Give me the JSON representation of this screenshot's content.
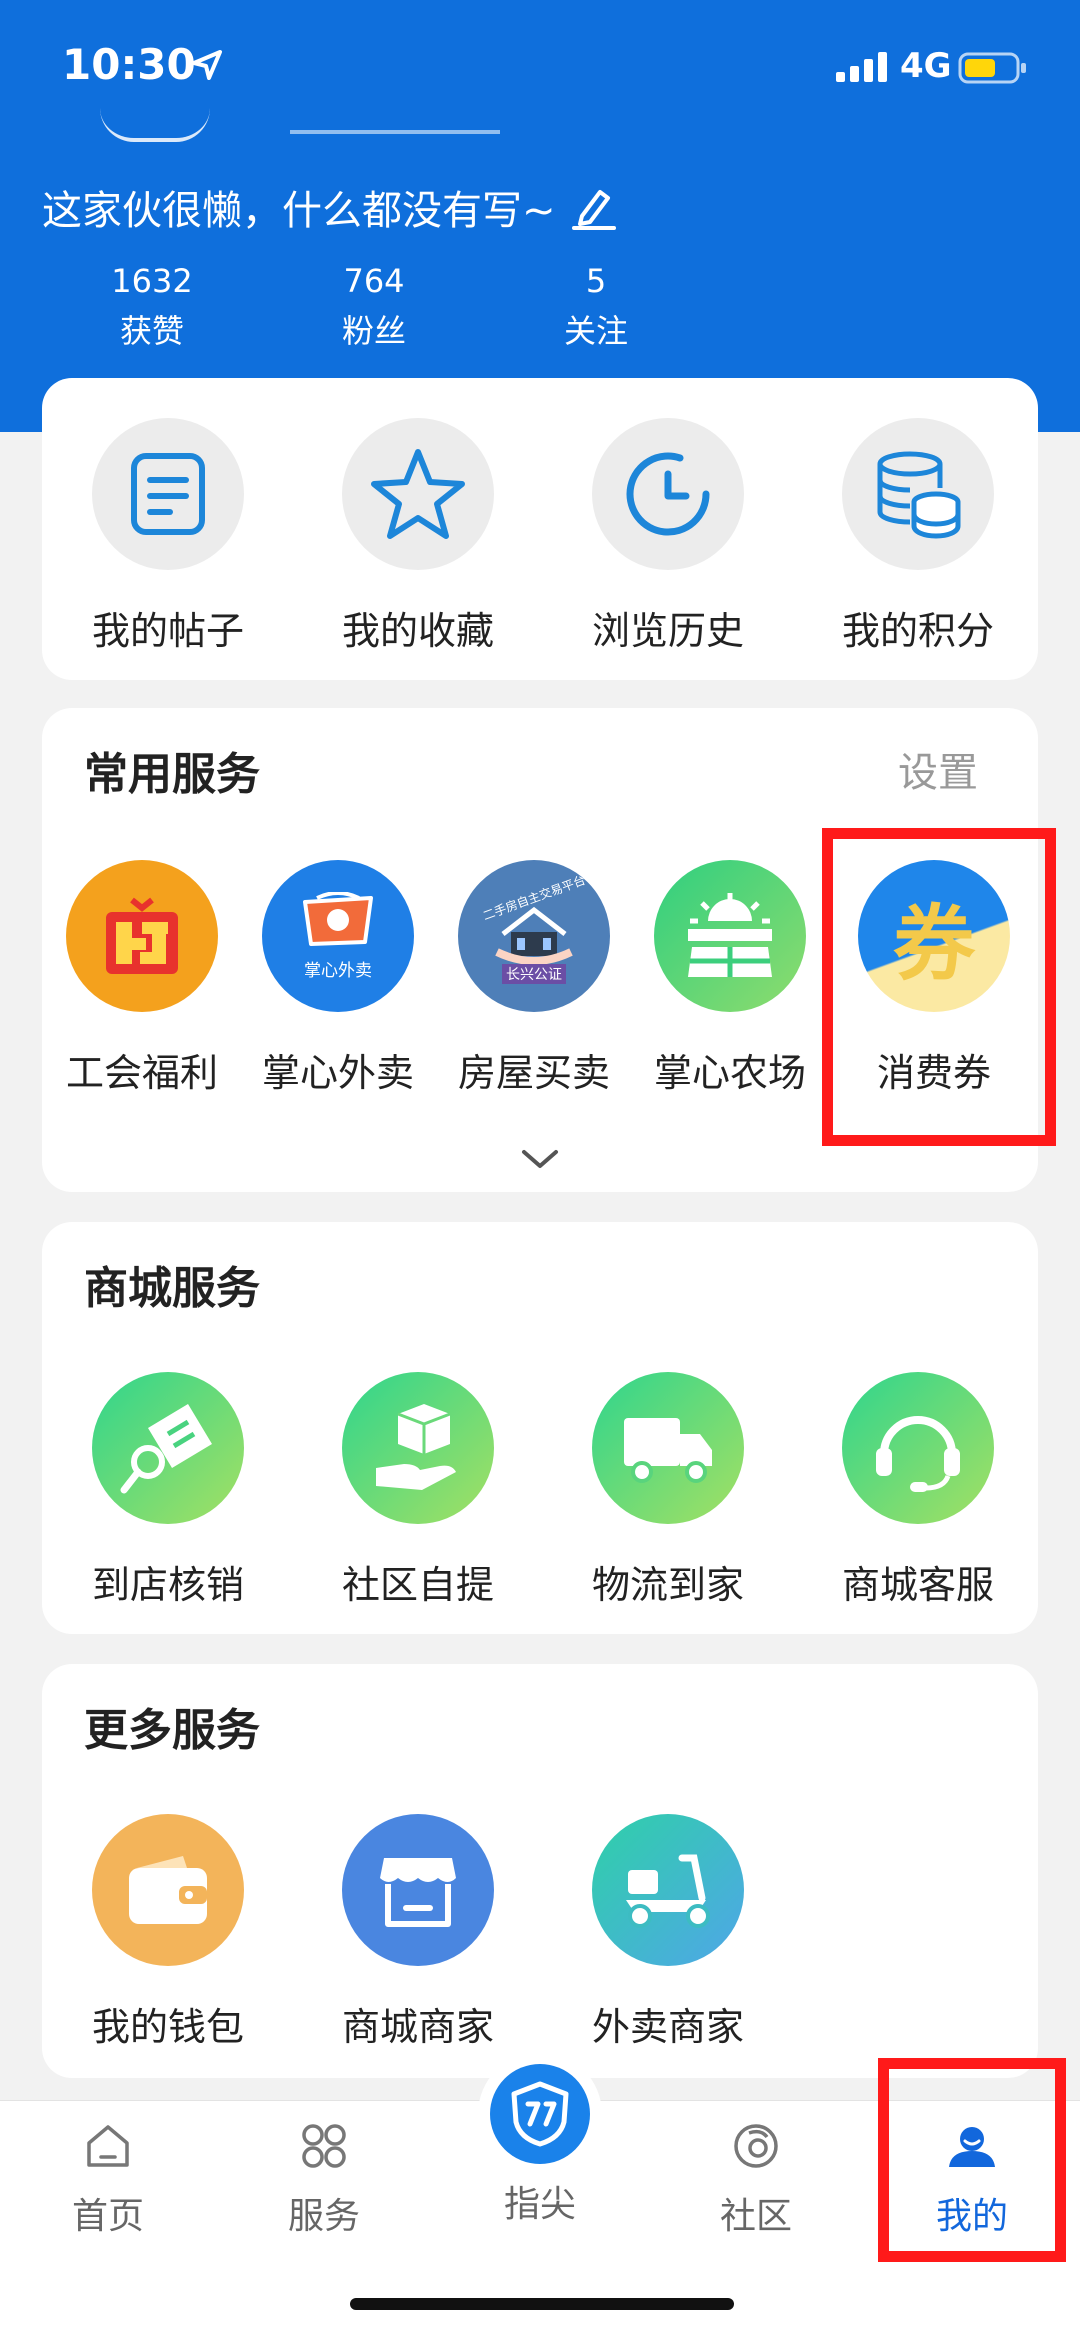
{
  "status_bar": {
    "time": "10:30",
    "network": "4G"
  },
  "profile": {
    "bio": "这家伙很懒，什么都没有写~",
    "stats": [
      {
        "value": "1632",
        "label": "获赞"
      },
      {
        "value": "764",
        "label": "粉丝"
      },
      {
        "value": "5",
        "label": "关注"
      }
    ]
  },
  "quick_actions": [
    {
      "label": "我的帖子",
      "icon": "document-icon"
    },
    {
      "label": "我的收藏",
      "icon": "star-icon"
    },
    {
      "label": "浏览历史",
      "icon": "clock-icon"
    },
    {
      "label": "我的积分",
      "icon": "coins-icon"
    }
  ],
  "common_services": {
    "title": "常用服务",
    "action": "设置",
    "items": [
      {
        "label": "工会福利",
        "icon": "union-welfare-icon",
        "color": "#f4a11d"
      },
      {
        "label": "掌心外卖",
        "icon": "takeout-icon",
        "color": "#1f7fe6",
        "icon_text": "掌心外卖"
      },
      {
        "label": "房屋买卖",
        "icon": "house-trade-icon",
        "color": "#4e7fb8",
        "icon_text": "长兴公证",
        "icon_text_top": "二手房自主交易平台"
      },
      {
        "label": "掌心农场",
        "icon": "farm-icon",
        "color": "#3ccf7d"
      },
      {
        "label": "消费券",
        "icon": "coupon-icon",
        "color": "#1f86ea",
        "icon_text": "券"
      }
    ]
  },
  "mall_services": {
    "title": "商城服务",
    "items": [
      {
        "label": "到店核销",
        "icon": "ticket-verify-icon"
      },
      {
        "label": "社区自提",
        "icon": "package-pickup-icon"
      },
      {
        "label": "物流到家",
        "icon": "truck-icon"
      },
      {
        "label": "商城客服",
        "icon": "headset-icon"
      }
    ]
  },
  "more_services": {
    "title": "更多服务",
    "items": [
      {
        "label": "我的钱包",
        "icon": "wallet-icon",
        "color": "#f3b45a"
      },
      {
        "label": "商城商家",
        "icon": "shop-icon",
        "color": "#4a86e0"
      },
      {
        "label": "外卖商家",
        "icon": "scooter-icon",
        "color": "#30c6b5"
      }
    ]
  },
  "tabbar": [
    {
      "label": "首页",
      "icon": "home-icon"
    },
    {
      "label": "服务",
      "icon": "grid-icon"
    },
    {
      "label": "指尖",
      "icon": "fingertip-logo-icon"
    },
    {
      "label": "社区",
      "icon": "community-icon"
    },
    {
      "label": "我的",
      "icon": "user-icon",
      "active": true
    }
  ],
  "colors": {
    "brand_blue": "#0f6fdc",
    "highlight_red": "#ff1a1a",
    "active_tab": "#1267dc"
  }
}
